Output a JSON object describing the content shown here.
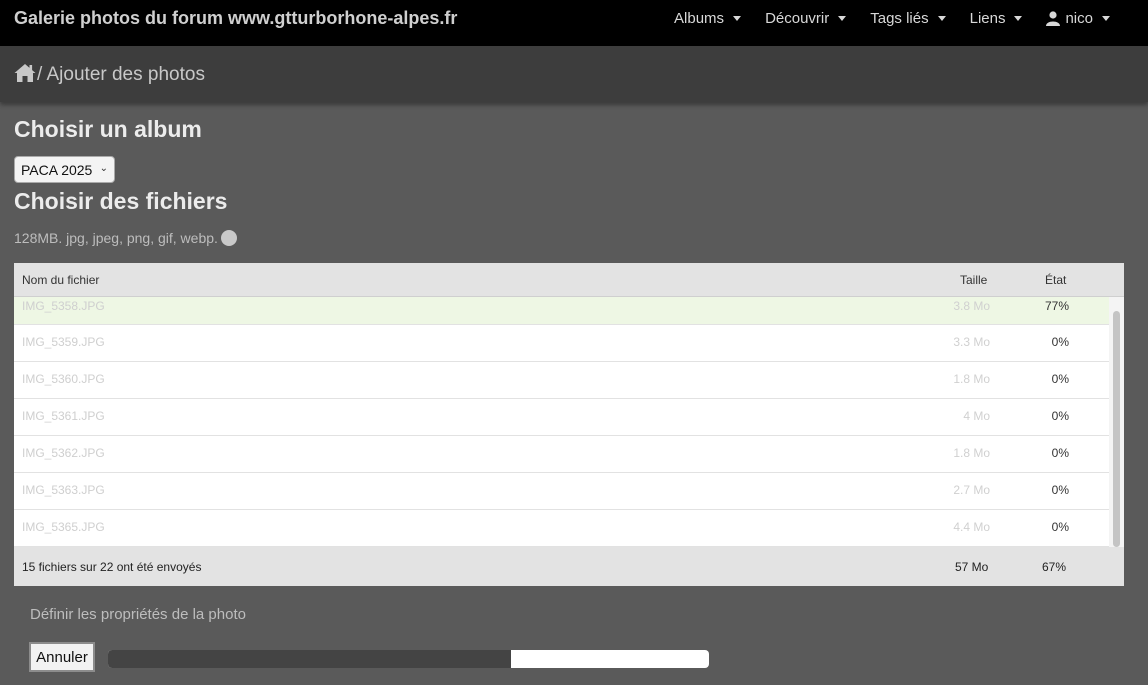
{
  "navbar": {
    "brand": "Galerie photos du forum www.gtturborhone-alpes.fr",
    "items": [
      {
        "label": "Albums"
      },
      {
        "label": "Découvrir"
      },
      {
        "label": "Tags liés"
      },
      {
        "label": "Liens"
      },
      {
        "label": "nico",
        "icon": "user-icon"
      }
    ]
  },
  "breadcrumb": {
    "icon": "home-icon",
    "label": "/ Ajouter des photos"
  },
  "album_section": {
    "title": "Choisir un album",
    "selected_album": "PACA 2025"
  },
  "files_section": {
    "title": "Choisir des fichiers",
    "formats": "128MB. jpg, jpeg, png, gif, webp."
  },
  "table": {
    "headers": {
      "name": "Nom du fichier",
      "size": "Taille",
      "state": "État"
    },
    "rows": [
      {
        "name": "IMG_5358.JPG",
        "size": "3.8 Mo",
        "state": "77%"
      },
      {
        "name": "IMG_5359.JPG",
        "size": "3.3 Mo",
        "state": "0%"
      },
      {
        "name": "IMG_5360.JPG",
        "size": "1.8 Mo",
        "state": "0%"
      },
      {
        "name": "IMG_5361.JPG",
        "size": "4 Mo",
        "state": "0%"
      },
      {
        "name": "IMG_5362.JPG",
        "size": "1.8 Mo",
        "state": "0%"
      },
      {
        "name": "IMG_5363.JPG",
        "size": "2.7 Mo",
        "state": "0%"
      },
      {
        "name": "IMG_5365.JPG",
        "size": "4.4 Mo",
        "state": "0%"
      }
    ],
    "footer": {
      "summary": "15 fichiers sur 22 ont été envoyés",
      "total_size": "57 Mo",
      "total_state": "67%"
    }
  },
  "actions": {
    "props_link": "Définir les propriétés de la photo",
    "cancel_label": "Annuler"
  },
  "upload_progress": 0.67,
  "colors": {
    "navbar": "#000000",
    "breadcrumb_bar": "#3d3d3d",
    "page_bg": "#5a5a5a",
    "active_row": "#eef7e4",
    "progress_fill": "#444444"
  }
}
